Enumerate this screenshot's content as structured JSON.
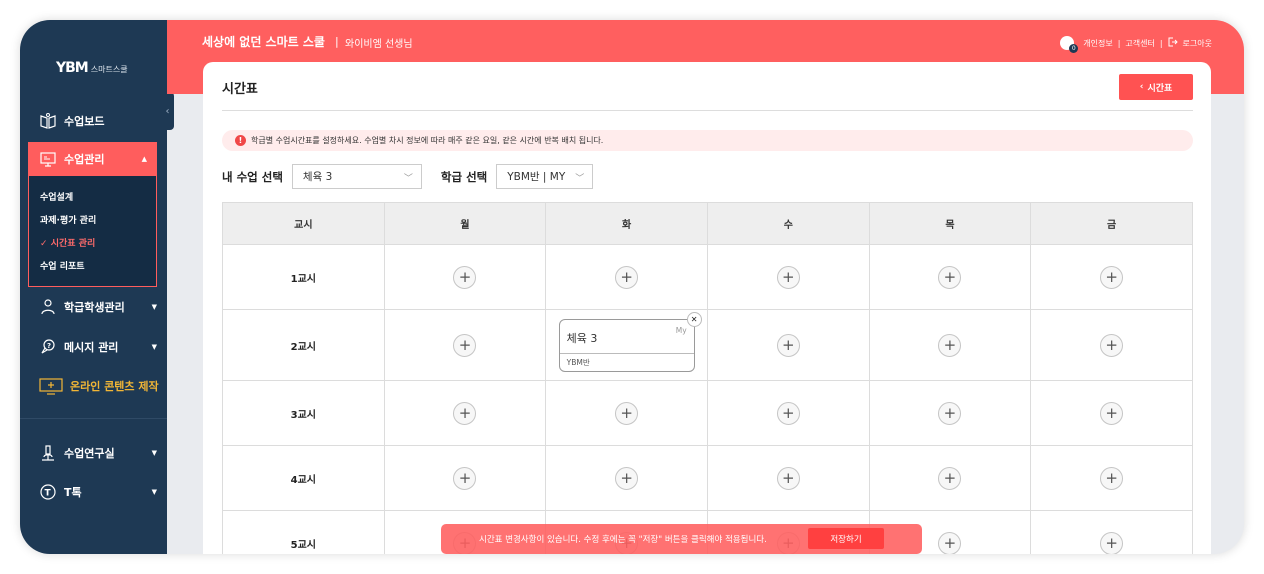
{
  "sidebar": {
    "logo_main": "YBM",
    "logo_sub": "스마트스쿨",
    "items": [
      {
        "label": "수업보드"
      },
      {
        "label": "수업관리"
      },
      {
        "label": "학급학생관리"
      },
      {
        "label": "메시지 관리"
      },
      {
        "label": "온라인 콘텐츠 제작"
      },
      {
        "label": "수업연구실"
      },
      {
        "label": "T톡"
      }
    ],
    "sub_items": [
      {
        "label": "수업설계"
      },
      {
        "label": "과제·평가 관리"
      },
      {
        "label": "시간표 관리"
      },
      {
        "label": "수업 리포트"
      }
    ],
    "collapse_glyph": "‹"
  },
  "header": {
    "title": "세상에 없던 스마트 스쿨",
    "separator": "|",
    "teacher": "와이비엠 선생님",
    "badge_count": "0",
    "links": [
      "개인정보",
      "고객센터",
      "로그아웃"
    ]
  },
  "page": {
    "title": "시간표",
    "back_button": "시간표",
    "notice": "학급별 수업시간표를 설정하세요. 수업별 차시 정보에 따라 매주 같은 요일, 같은 시간에 반복 배치 됩니다.",
    "course_label": "내 수업 선택",
    "course_value": "체육 3",
    "class_label": "학급 선택",
    "class_value": "YBM반 | MY"
  },
  "timetable": {
    "headers": [
      "교시",
      "월",
      "화",
      "수",
      "목",
      "금"
    ],
    "periods": [
      "1교시",
      "2교시",
      "3교시",
      "4교시",
      "5교시"
    ],
    "card": {
      "subject": "체육 3",
      "tag": "My",
      "class": "YBM반"
    }
  },
  "toast": {
    "message": "시간표 변경사항이 있습니다. 수정 후에는 꼭 \"저장\" 버튼을 클릭해야 적용됩니다.",
    "button": "저장하기"
  },
  "colors": {
    "accent": "#ff5f5f",
    "sidebar": "#1e3954",
    "orange": "#f2b636"
  }
}
